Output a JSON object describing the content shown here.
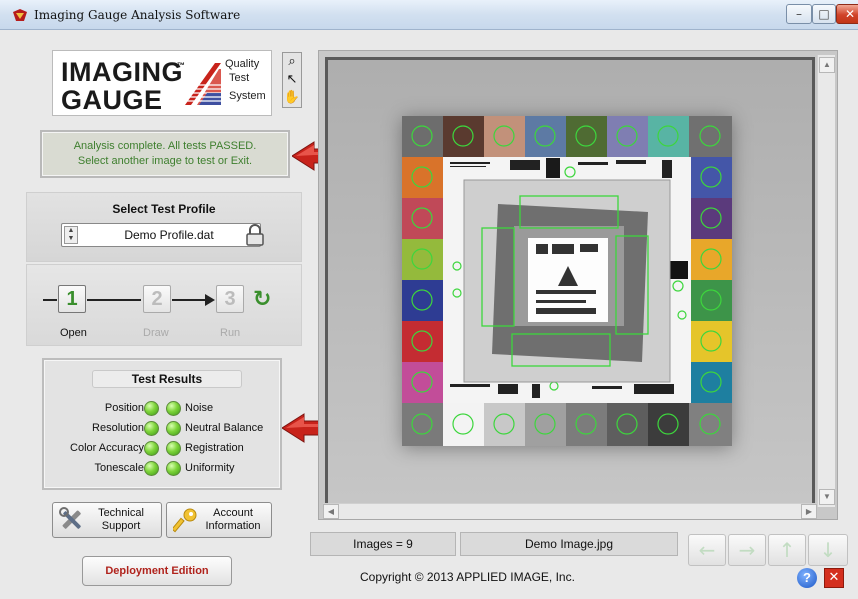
{
  "window": {
    "title": "Imaging Gauge Analysis Software",
    "min_glyph": "–",
    "max_glyph": "□",
    "close_glyph": "✕"
  },
  "logo": {
    "line1": "IMAGING",
    "trademark": "™",
    "line2": "GAUGE",
    "tagline": [
      "Quality",
      "Test",
      "System"
    ]
  },
  "tools": {
    "zoom_glyph": "⌕",
    "pointer_glyph": "↖",
    "pan_glyph": "✋"
  },
  "status": {
    "line1": "Analysis complete.  All tests PASSED.",
    "line2": "Select another image to test or Exit.",
    "color": "#3e7f2e"
  },
  "profile": {
    "header": "Select Test Profile",
    "value": "Demo Profile.dat"
  },
  "steps": [
    {
      "number": "1",
      "label": "Open",
      "enabled": true
    },
    {
      "number": "2",
      "label": "Draw",
      "enabled": false
    },
    {
      "number": "3",
      "label": "Run",
      "enabled": false
    }
  ],
  "reset_glyph": "↻",
  "results": {
    "header": "Test Results",
    "rows": [
      {
        "left": "Position",
        "right": "Noise"
      },
      {
        "left": "Resolution",
        "right": "Neutral Balance"
      },
      {
        "left": "Color Accuracy",
        "right": "Registration"
      },
      {
        "left": "Tonescale",
        "right": "Uniformity"
      }
    ],
    "pass_color": "#7ed43a"
  },
  "buttons": {
    "support_line1": "Technical",
    "support_line2": "Support",
    "account_line1": "Account",
    "account_line2": "Information",
    "deploy": "Deployment Edition"
  },
  "viewer": {
    "images_count": "Images = 9",
    "filename": "Demo Image.jpg"
  },
  "nav": {
    "left": "←",
    "right": "→",
    "up": "↑",
    "down": "↓"
  },
  "footer": {
    "copyright": "Copyright © 2013 APPLIED IMAGE, Inc.",
    "help_glyph": "?",
    "exit_glyph": "✕"
  },
  "colors": {
    "accent_green": "#3a8f2d",
    "arrow_red": "#c8231b",
    "deploy_red": "#b0231c"
  }
}
